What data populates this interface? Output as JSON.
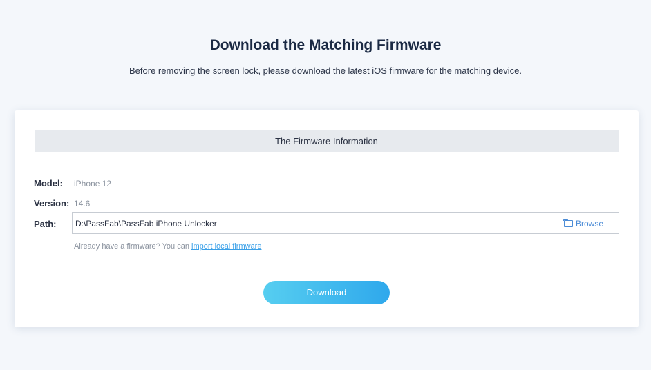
{
  "header": {
    "title": "Download the Matching Firmware",
    "subtitle": "Before removing the screen lock, please download the latest iOS firmware for the matching device."
  },
  "firmware_card": {
    "section_title": "The Firmware Information",
    "model_label": "Model:",
    "model_value": "iPhone 12",
    "version_label": "Version:",
    "version_value": "14.6",
    "path_label": "Path:",
    "path_value": "D:\\PassFab\\PassFab iPhone Unlocker",
    "browse_label": "Browse",
    "browse_icon": "folder-icon",
    "hint_text": "Already have a firmware? You can ",
    "hint_link": "import local firmware",
    "download_label": "Download"
  },
  "colors": {
    "accent": "#2fa8ec",
    "link": "#3aa0e8",
    "background": "#f4f7fb"
  }
}
